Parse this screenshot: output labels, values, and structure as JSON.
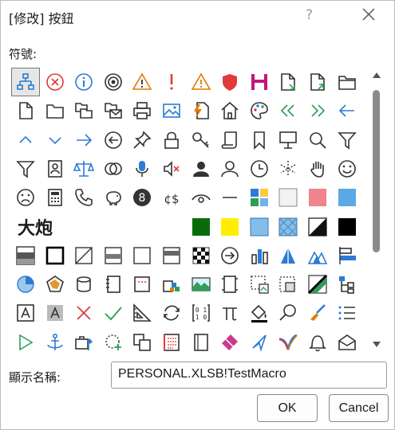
{
  "dialog": {
    "title": "[修改] 按鈕",
    "help_symbol": "?",
    "symbols_label": "符號:",
    "display_name_label": "顯示名稱:",
    "display_name_value": "PERSONAL.XLSB!TestMacro",
    "ok_label": "OK",
    "cancel_label": "Cancel",
    "big_text_symbol": "大炮",
    "numbered_circle": "8",
    "currency_symbol": "¢$"
  },
  "colors": {
    "blue": "#2b7cd3",
    "red": "#e03a3a",
    "orange": "#e07b00",
    "green": "#2e9e57",
    "magenta": "#c2187a",
    "dark": "#333333"
  },
  "icons": [
    "org-chart-icon",
    "cancel-circle-icon",
    "info-icon",
    "target-icon",
    "warning-orange-icon",
    "exclamation-icon",
    "warning-icon",
    "shield-icon",
    "save-icon",
    "document-export-icon",
    "document-share-icon",
    "folder-icon",
    "document-icon",
    "folder-outline-icon",
    "copy-folder-icon",
    "mail-folder-icon",
    "printer-icon",
    "picture-icon",
    "lightning-document-icon",
    "home-icon",
    "palette-icon",
    "double-left-arrow-icon",
    "double-right-arrow-icon",
    "left-arrow-icon",
    "chevron-up-icon",
    "chevron-down-icon",
    "right-arrow-icon",
    "circle-left-arrow-icon",
    "pin-icon",
    "lock-icon",
    "key-icon",
    "scroll-icon",
    "bookmark-icon",
    "presentation-icon",
    "search-icon",
    "filter-icon",
    "filter-outline-icon",
    "contact-card-icon",
    "scales-icon",
    "overlap-circles-icon",
    "microphone-icon",
    "mute-icon",
    "person-filled-icon",
    "person-outline-icon",
    "clock-icon",
    "snowflake-icon",
    "hand-icon",
    "smiley-icon",
    "sad-face-icon",
    "calculator-icon",
    "phone-icon",
    "piggy-bank-icon",
    "number-circle-icon",
    "currency-icon",
    "eye-icon",
    "dash-icon",
    "color-squares-icon",
    "light-gray-square-icon",
    "pink-square-icon",
    "blue-square-icon",
    "big-text-icon",
    "green-square-icon",
    "yellow-square-icon",
    "light-blue-square-icon",
    "pattern-square-icon",
    "half-black-square-icon",
    "black-square-icon",
    "gradient-bar-icon",
    "black-outline-square-icon",
    "diagonal-square-icon",
    "half-gray-square-icon",
    "white-square-icon",
    "gray-bar-square-icon",
    "checker-square-icon",
    "circle-right-arrow-icon",
    "bar-chart-icon",
    "pyramid-icon",
    "mountain-icon",
    "align-left-chart-icon",
    "pie-chart-icon",
    "radar-chart-icon",
    "database-icon",
    "notebook-icon",
    "server-icon",
    "cube-group-icon",
    "landscape-icon",
    "frame-icon",
    "chart-image-icon",
    "selection-icon",
    "color-stripes-icon",
    "hierarchy-icon",
    "text-box-icon",
    "text-box-gray-icon",
    "cross-icon",
    "check-icon",
    "ruler-icon",
    "refresh-icon",
    "binary-icon",
    "pi-icon",
    "fill-bucket-icon",
    "magnifier-icon",
    "brush-icon",
    "list-icon",
    "play-icon",
    "anchor-icon",
    "toolbox-icon",
    "add-circle-icon",
    "copy-icon",
    "document-list-icon",
    "blank-page-icon",
    "eraser-icon",
    "cursor-arrow-icon",
    "colorful-bird-icon",
    "bell-icon",
    "mail-open-icon"
  ]
}
